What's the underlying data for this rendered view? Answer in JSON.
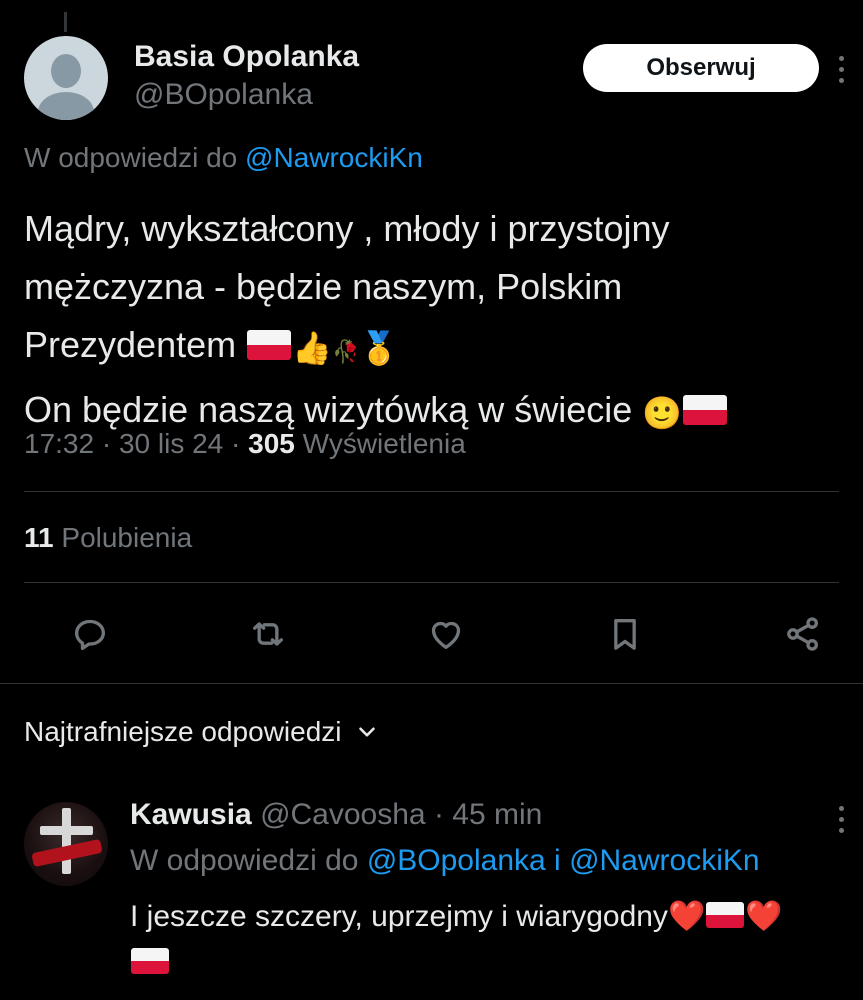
{
  "tweet": {
    "display_name": "Basia Opolanka",
    "handle": "@BOpolanka",
    "follow_label": "Obserwuj",
    "reply_to_prefix": "W odpowiedzi do",
    "reply_to_mention": "@NawrockiKn",
    "text_lines": [
      "Mądry, wykształcony , młody i przystojny",
      "mężczyzna  - będzie naszym, Polskim",
      "Prezydentem",
      "On będzie naszą wizytówką w świecie"
    ],
    "emoji_line3": [
      "flag-pl",
      "👍",
      "🥀",
      "🥇"
    ],
    "emoji_line4": [
      "🙂",
      "flag-pl"
    ],
    "time": "17:32",
    "date": "30 lis 24",
    "views_count": "305",
    "views_label": "Wyświetlenia",
    "likes_count": "11",
    "likes_label": "Polubienia"
  },
  "actions": [
    {
      "name": "reply-icon"
    },
    {
      "name": "retweet-icon"
    },
    {
      "name": "like-icon"
    },
    {
      "name": "bookmark-icon"
    },
    {
      "name": "share-icon"
    }
  ],
  "replies_section": {
    "sort_label": "Najtrafniejsze odpowiedzi"
  },
  "reply": {
    "display_name": "Kawusia",
    "handle": "@Cavoosha",
    "time_ago": "45 min",
    "reply_to_prefix": "W odpowiedzi do",
    "reply_to_mention_1": "@BOpolanka",
    "reply_to_joiner": "i",
    "reply_to_mention_2": "@NawrockiKn",
    "text": "I jeszcze szczery, uprzejmy i wiarygodny"
  },
  "colors": {
    "background": "#000000",
    "text": "#e7e9ea",
    "secondary": "#71767b",
    "link": "#1d9bf0",
    "divider": "#2f3336",
    "flag_red": "#dc143c"
  }
}
